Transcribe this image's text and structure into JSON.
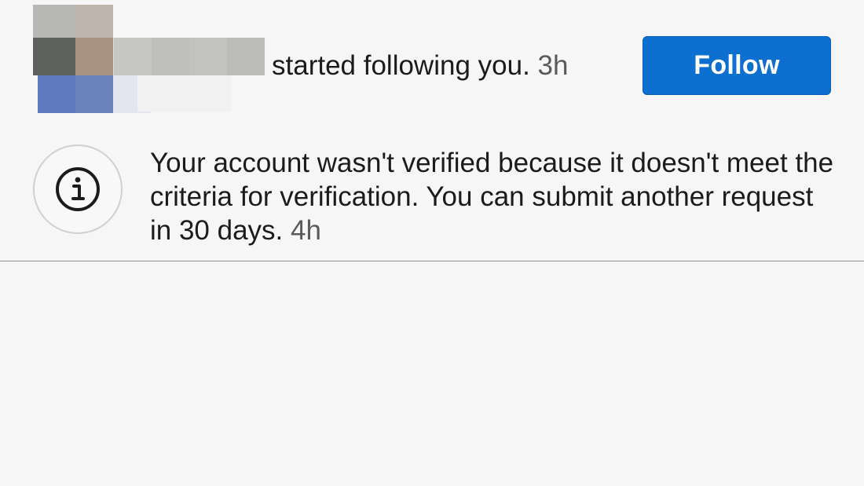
{
  "follow_notification": {
    "message": "started following you.",
    "time": "3h",
    "button_label": "Follow",
    "button_color": "#0d6fd0"
  },
  "verification_notification": {
    "message": "Your account wasn't verified because it doesn't meet the criteria for verification. You can submit another request in 30 days.",
    "time": "4h",
    "icon": "info-icon"
  },
  "colors": {
    "background": "#f6f6f6",
    "text": "#1b1b1b",
    "timestamp": "#5a5a5a",
    "divider": "#8f8f8f"
  }
}
